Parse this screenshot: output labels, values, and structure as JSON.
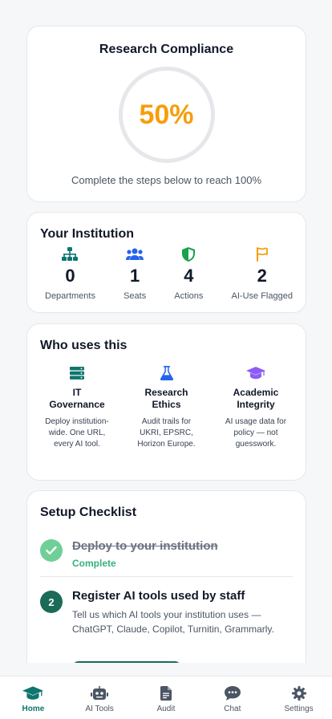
{
  "compliance": {
    "title": "Research Compliance",
    "percent_label": "50%",
    "percent": 50,
    "subtitle": "Complete the steps below to reach 100%",
    "accent": "#f59e0b"
  },
  "institution": {
    "title": "Your Institution",
    "stats": [
      {
        "value": "0",
        "label": "Departments",
        "icon": "org-chart-icon",
        "color": "#0f766e"
      },
      {
        "value": "1",
        "label": "Seats",
        "icon": "users-icon",
        "color": "#2563eb"
      },
      {
        "value": "4",
        "label": "Actions",
        "icon": "shield-icon",
        "color": "#16a34a"
      },
      {
        "value": "2",
        "label": "AI-Use Flagged",
        "icon": "flag-icon",
        "color": "#f59e0b"
      }
    ]
  },
  "who": {
    "title": "Who uses this",
    "columns": [
      {
        "name": "IT Governance",
        "desc": "Deploy institution-wide. One URL, every AI tool.",
        "icon": "server-icon",
        "color": "#0f766e"
      },
      {
        "name": "Research Ethics",
        "desc": "Audit trails for UKRI, EPSRC, Horizon Europe.",
        "icon": "flask-icon",
        "color": "#2563eb"
      },
      {
        "name": "Academic Integrity",
        "desc": "AI usage data for policy — not guesswork.",
        "icon": "graduation-cap-icon",
        "color": "#8b5cf6"
      }
    ]
  },
  "checklist": {
    "title": "Setup Checklist",
    "steps": [
      {
        "title": "Deploy to your institution",
        "status": "Complete",
        "done": true
      },
      {
        "number": "2",
        "title": "Register AI tools used by staff",
        "desc": "Tell us which AI tools your institution uses — ChatGPT, Claude, Copilot, Turnitin, Grammarly.",
        "done": false
      }
    ]
  },
  "nav": {
    "items": [
      {
        "label": "Home",
        "icon": "graduation-cap-icon",
        "active": true
      },
      {
        "label": "AI Tools",
        "icon": "robot-icon",
        "active": false
      },
      {
        "label": "Audit",
        "icon": "document-icon",
        "active": false
      },
      {
        "label": "Chat",
        "icon": "chat-icon",
        "active": false
      },
      {
        "label": "Settings",
        "icon": "gear-icon",
        "active": false
      }
    ]
  }
}
